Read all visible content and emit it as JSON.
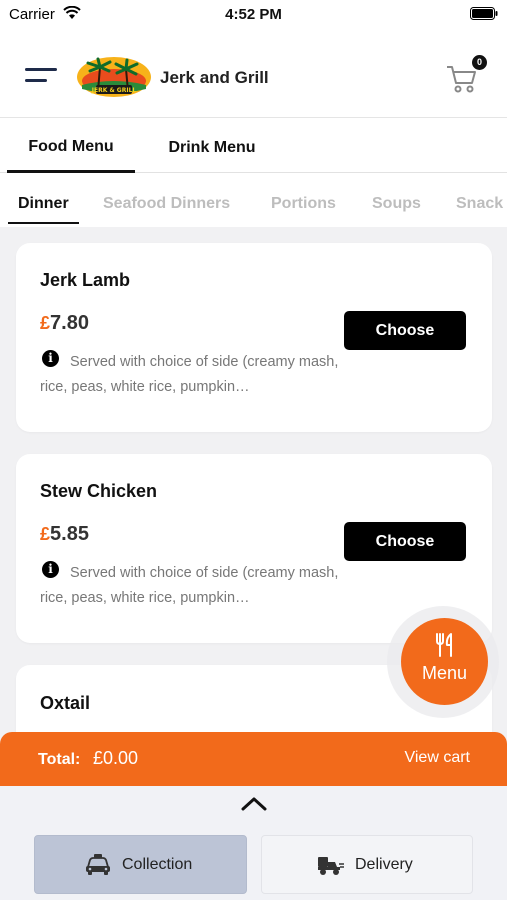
{
  "status_bar": {
    "carrier": "Carrier",
    "time": "4:52 PM"
  },
  "header": {
    "title": "Jerk and Grill",
    "logo_text": "JERK & GRILL",
    "cart_count": "0"
  },
  "main_tabs": [
    {
      "label": "Food Menu",
      "active": true
    },
    {
      "label": "Drink Menu",
      "active": false
    }
  ],
  "sub_tabs": [
    {
      "label": "Dinner",
      "active": true
    },
    {
      "label": "Seafood Dinners",
      "active": false
    },
    {
      "label": "Portions",
      "active": false
    },
    {
      "label": "Soups",
      "active": false
    },
    {
      "label": "Snack",
      "active": false
    }
  ],
  "menu_items": [
    {
      "name": "Jerk Lamb",
      "currency": "£",
      "price": "7.80",
      "choose_label": "Choose",
      "info_glyph": "i",
      "description": "Served with choice of side (creamy mash, rice, peas, white rice, pumpkin…"
    },
    {
      "name": "Stew Chicken",
      "currency": "£",
      "price": "5.85",
      "choose_label": "Choose",
      "info_glyph": "i",
      "description": "Served with choice of side (creamy mash, rice, peas, white rice, pumpkin…"
    },
    {
      "name": "Oxtail"
    }
  ],
  "fab": {
    "label": "Menu",
    "icon": "fork-knife-icon"
  },
  "total_bar": {
    "label": "Total:",
    "value": "£0.00",
    "view_cart": "View cart"
  },
  "order_modes": [
    {
      "label": "Collection",
      "icon": "collection-icon",
      "selected": true
    },
    {
      "label": "Delivery",
      "icon": "delivery-icon",
      "selected": false
    }
  ],
  "colors": {
    "accent": "#f26a1b",
    "button": "#000000",
    "selected_mode": "#bcc4d6"
  }
}
